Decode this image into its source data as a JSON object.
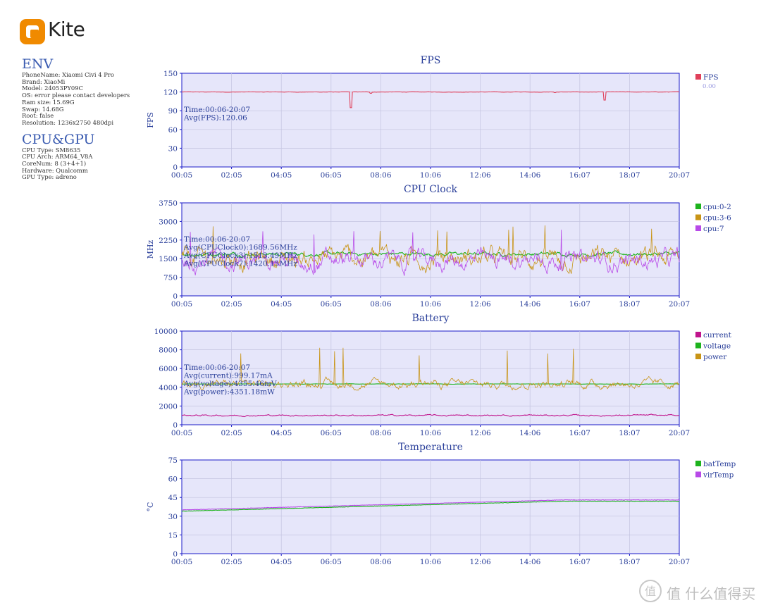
{
  "logo": {
    "text": "Kite",
    "color": "#f08a00"
  },
  "env": {
    "title": "ENV",
    "lines": [
      "PhoneName: Xiaomi Civi 4 Pro",
      "Brand: XiaoMi",
      "Model: 24053PY09C",
      "OS: error please contact developers",
      "Ram size: 15.69G",
      "Swap: 14.68G",
      "Root: false",
      "Resolution: 1236x2750 480dpi"
    ]
  },
  "cpugpu": {
    "title": "CPU&GPU",
    "lines": [
      "CPU Type: SM8635",
      "CPU Arch: ARM64_V8A",
      "CoreNum: 8 (3+4+1)",
      "Hardware: Qualcomm",
      "GPU Type: adreno"
    ]
  },
  "x_ticks": [
    "00:05",
    "02:05",
    "04:05",
    "06:05",
    "08:06",
    "10:06",
    "12:06",
    "14:06",
    "16:07",
    "18:07",
    "20:07"
  ],
  "chart_data": [
    {
      "type": "line",
      "title": "FPS",
      "ylabel": "FPS",
      "ylim": [
        0,
        150
      ],
      "yticks": [
        "0",
        "30",
        "60",
        "90",
        "120",
        "150"
      ],
      "x_range": [
        "00:05",
        "20:07"
      ],
      "grid": true,
      "legend_placement": "right",
      "annotations": [
        "Time:00:06-20:07",
        "Avg(FPS):120.06"
      ],
      "legend_extra": "0.00",
      "series": [
        {
          "name": "FPS",
          "color": "#e0405a",
          "base": 120,
          "noise": 0.3,
          "dips": [
            [
              0.34,
              95
            ],
            [
              0.38,
              118
            ],
            [
              0.75,
              119
            ],
            [
              0.85,
              107
            ]
          ]
        }
      ]
    },
    {
      "type": "line",
      "title": "CPU Clock",
      "ylabel": "MHz",
      "ylim": [
        0,
        3750
      ],
      "yticks": [
        "0",
        "750",
        "1500",
        "2250",
        "3000",
        "3750"
      ],
      "x_range": [
        "00:05",
        "20:07"
      ],
      "grid": true,
      "legend_placement": "right",
      "annotations": [
        "Time:00:06-20:07",
        "Avg(CPUClock0):1689.56MHz",
        "Avg(CPUClock3):1513.49MHz",
        "Avg(CPUClock7):1420.15MHz"
      ],
      "series": [
        {
          "name": "cpu:0-2",
          "color": "#1db31d",
          "base": 1690,
          "noise": 80
        },
        {
          "name": "cpu:3-6",
          "color": "#c89416",
          "base": 1513,
          "noise": 420
        },
        {
          "name": "cpu:7",
          "color": "#b84ae8",
          "base": 1420,
          "noise": 380
        }
      ]
    },
    {
      "type": "line",
      "title": "Battery",
      "ylabel": "",
      "ylim": [
        0,
        10000
      ],
      "yticks": [
        "0",
        "2000",
        "4000",
        "6000",
        "8000",
        "10000"
      ],
      "x_range": [
        "00:05",
        "20:07"
      ],
      "grid": true,
      "legend_placement": "right",
      "annotations": [
        "Time:00:06-20:07",
        "Avg(current):999.17mA",
        "Avg(voltage):4355.46mV",
        "Avg(power):4351.18mW"
      ],
      "series": [
        {
          "name": "current",
          "color": "#c0148c",
          "base": 999,
          "noise": 80
        },
        {
          "name": "voltage",
          "color": "#1db31d",
          "base": 4355,
          "noise": 20
        },
        {
          "name": "power",
          "color": "#c89416",
          "base": 4351,
          "noise": 450
        }
      ]
    },
    {
      "type": "line",
      "title": "Temperature",
      "ylabel": "°C",
      "ylim": [
        0,
        75
      ],
      "yticks": [
        "0",
        "15",
        "30",
        "45",
        "60",
        "75"
      ],
      "x_range": [
        "00:05",
        "20:07"
      ],
      "grid": true,
      "legend_placement": "right",
      "annotations": [],
      "series": [
        {
          "name": "batTemp",
          "color": "#1db31d",
          "start": 34,
          "end": 42
        },
        {
          "name": "virTemp",
          "color": "#b84ae8",
          "start": 35,
          "end": 43
        }
      ]
    }
  ],
  "watermark": {
    "text": "值 什么值得买"
  }
}
